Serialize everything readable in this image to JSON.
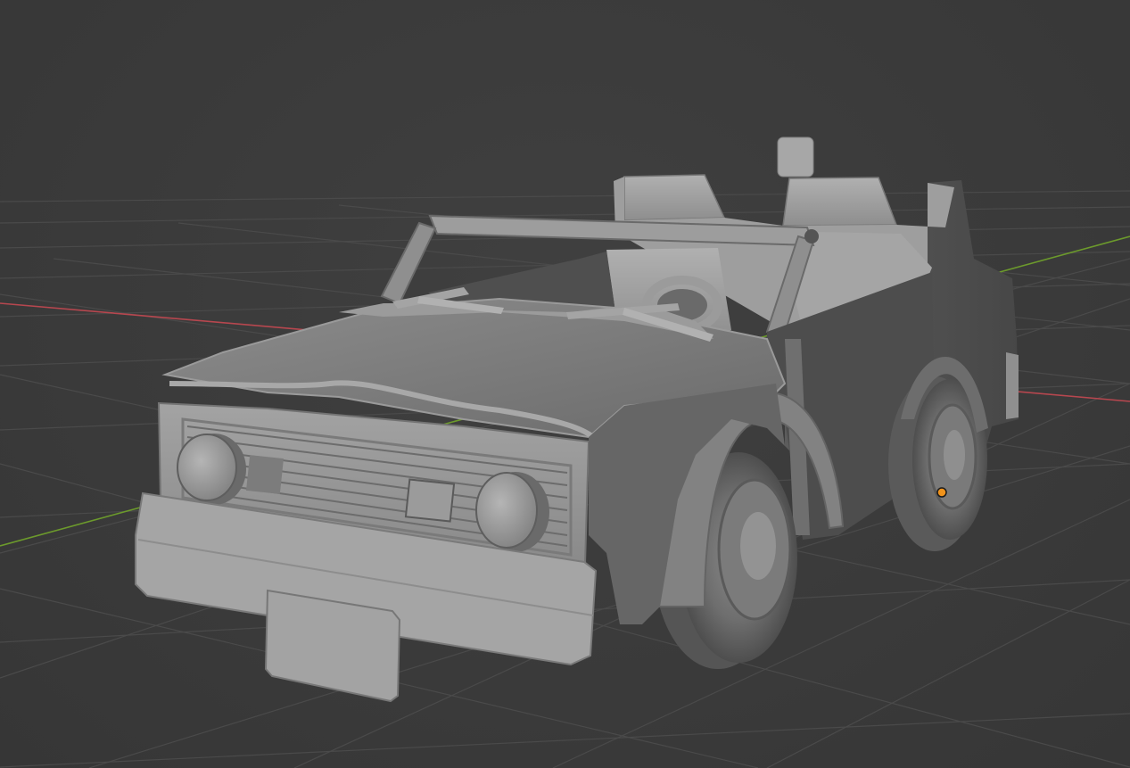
{
  "viewport": {
    "background_color": "#3d3d3d",
    "grid_color": "#4a4a4a",
    "x_axis_color": "#b7474f",
    "y_axis_color": "#6c9a2c",
    "origin_color": "#f0931c",
    "object": {
      "icon": "car-model",
      "shading": "solid"
    }
  }
}
